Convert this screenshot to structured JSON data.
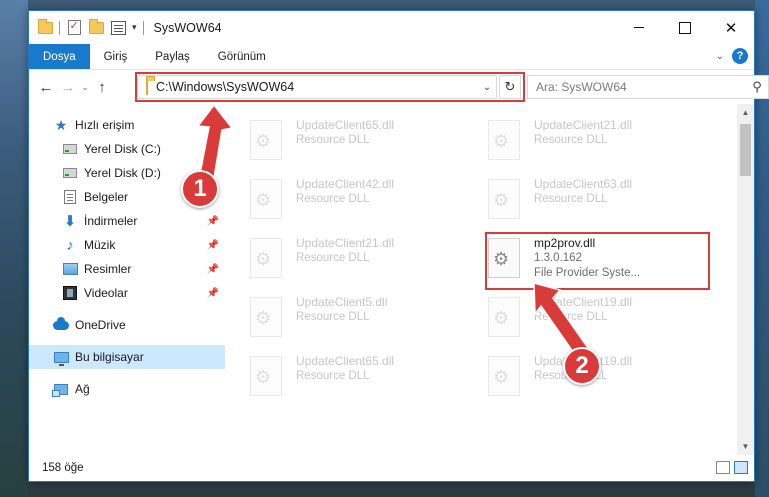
{
  "window": {
    "title": "SysWOW64",
    "controls": {
      "minimize": "–",
      "maximize": "□",
      "close": "✕"
    }
  },
  "ribbon": {
    "tabs": [
      {
        "label": "Dosya",
        "active": true
      },
      {
        "label": "Giriş"
      },
      {
        "label": "Paylaş"
      },
      {
        "label": "Görünüm"
      }
    ],
    "help": "?"
  },
  "navigation": {
    "address": "C:\\Windows\\SysWOW64",
    "search_placeholder": "Ara: SysWOW64"
  },
  "sidebar": {
    "items": [
      {
        "label": "Hızlı erişim",
        "icon": "star-icon"
      },
      {
        "label": "Yerel Disk (C:)",
        "icon": "drive-icon"
      },
      {
        "label": "Yerel Disk (D:)",
        "icon": "drive-icon"
      },
      {
        "label": "Belgeler",
        "icon": "documents-icon"
      },
      {
        "label": "İndirmeler",
        "icon": "downloads-icon"
      },
      {
        "label": "Müzik",
        "icon": "music-icon"
      },
      {
        "label": "Resimler",
        "icon": "pictures-icon"
      },
      {
        "label": "Videolar",
        "icon": "videos-icon"
      },
      {
        "label": "OneDrive",
        "icon": "onedrive-icon"
      },
      {
        "label": "Bu bilgisayar",
        "icon": "this-pc-icon",
        "selected": true
      },
      {
        "label": "Ağ",
        "icon": "network-icon"
      }
    ]
  },
  "files": [
    {
      "name": "UpdateClient65.dll",
      "desc": "Resource DLL"
    },
    {
      "name": "UpdateClient21.dll",
      "desc": "Resource DLL"
    },
    {
      "name": "UpdateClient42.dll",
      "desc": "Resource DLL"
    },
    {
      "name": "UpdateClient63.dll",
      "desc": "Resource DLL"
    },
    {
      "name": "UpdateClient21.dll",
      "desc": "Resource DLL"
    },
    {
      "name": "mp2prov.dll",
      "version": "1.3.0.162",
      "desc": "File Provider Syste..."
    },
    {
      "name": "UpdateClient5.dll",
      "desc": "Resource DLL"
    },
    {
      "name": "UpdateClient19.dll",
      "desc": "Resource DLL"
    },
    {
      "name": "UpdateClient65.dll",
      "desc": "Resource DLL"
    },
    {
      "name": "UpdateClient19.dll",
      "desc": "Resource DLL"
    }
  ],
  "status": {
    "count": "158 öğe"
  },
  "callouts": {
    "one": "1",
    "two": "2",
    "color": "#d93b3b"
  }
}
